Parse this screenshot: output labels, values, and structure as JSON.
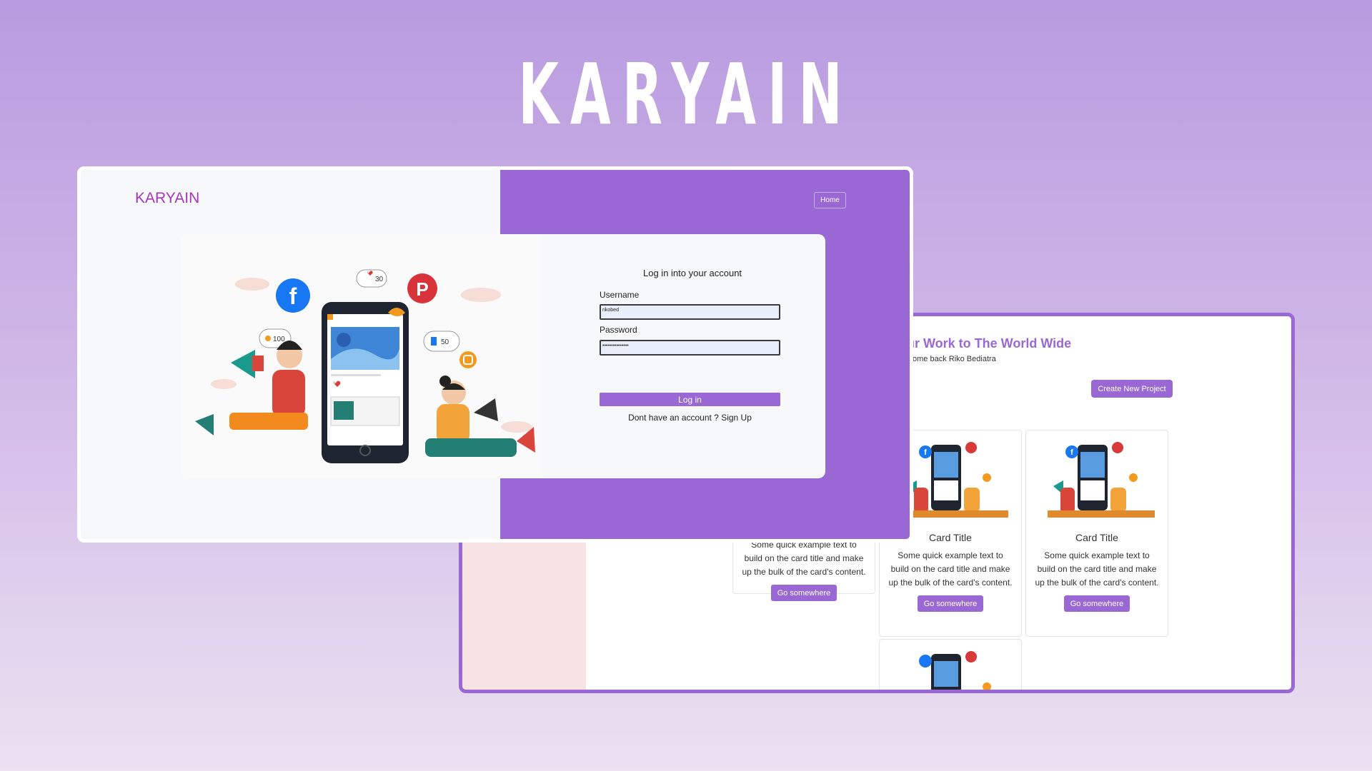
{
  "hero": {
    "title": "KARYAIN"
  },
  "login_window": {
    "brand": "KARYAIN",
    "nav": {
      "home_label": "Home"
    },
    "form": {
      "title": "Log in into your account",
      "username_label": "Username",
      "username_value": "rikobed",
      "password_label": "Password",
      "password_value": "•••••••••••••••",
      "submit_label": "Log in",
      "signup_prompt": "Dont have an account ?",
      "signup_link": "Sign Up"
    },
    "illustration_badges": {
      "likes": "30",
      "followers": "100",
      "thumbs": "50"
    }
  },
  "dashboard_window": {
    "heading": "ur Work to The World Wide",
    "subheading": "ome back Riko Bediatra",
    "create_button": "Create New Project",
    "cards": [
      {
        "title": "",
        "text": "Some quick example text to build on the card title and make up the bulk of the card's content.",
        "button": "Go somewhere"
      },
      {
        "title": "Card Title",
        "text": "Some quick example text to build on the card title and make up the bulk of the card's content.",
        "button": "Go somewhere"
      },
      {
        "title": "Card Title",
        "text": "Some quick example text to build on the card title and make up the bulk of the card's content.",
        "button": "Go somewhere"
      }
    ]
  },
  "colors": {
    "accent": "#9a68d5",
    "brand": "#a437b8",
    "sidebar": "#f7e3e3",
    "facebook": "#1877f2",
    "pinterest": "#e60023"
  },
  "icons": [
    "facebook-icon",
    "pinterest-icon",
    "instagram-icon",
    "megaphone-icon",
    "heart-icon",
    "like-icon"
  ]
}
